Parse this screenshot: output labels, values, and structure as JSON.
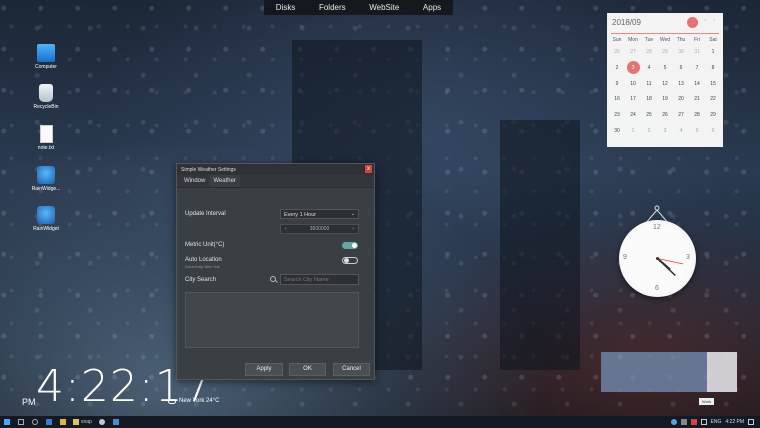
{
  "topbar": {
    "items": [
      "Disks",
      "Folders",
      "WebSite",
      "Apps"
    ]
  },
  "desktop_icons": [
    {
      "label": "Computer",
      "icon": "computer-icon"
    },
    {
      "label": "RecycleBin",
      "icon": "recycle-bin-icon"
    },
    {
      "label": "note.txt",
      "icon": "text-file-icon"
    },
    {
      "label": "RainWidge...",
      "icon": "rain-widget-icon"
    },
    {
      "label": "RainWidget",
      "icon": "rain-widget-gear-icon"
    }
  ],
  "big_clock": {
    "time": "4:22:17",
    "meridiem": "PM"
  },
  "weather_mini": {
    "text": "New York 24°C",
    "icon": "cloud-icon"
  },
  "dialog": {
    "title": "Simple Weather Settings",
    "close": "x",
    "tabs": [
      "Window",
      "Weather"
    ],
    "active_tab": "Weather",
    "update_interval_label": "Update Interval",
    "update_interval_value": "Every 1 Hour",
    "interval_seconds": "3600000",
    "metric_label": "Metric Unit(°C)",
    "metric_on": true,
    "auto_location_label": "Auto Location",
    "auto_location_sub": "Current city: New York",
    "auto_location_on": false,
    "city_search_label": "City Search",
    "city_search_placeholder": "Search City Name",
    "buttons": {
      "apply": "Apply",
      "ok": "OK",
      "cancel": "Cancel"
    }
  },
  "calendar": {
    "header": "2018/09",
    "weekdays": [
      "Sun",
      "Mon",
      "Tue",
      "Wed",
      "Thu",
      "Fri",
      "Sat"
    ],
    "weeks": [
      [
        "26",
        "27",
        "28",
        "29",
        "30",
        "31",
        "1"
      ],
      [
        "2",
        "3",
        "4",
        "5",
        "6",
        "7",
        "8"
      ],
      [
        "9",
        "10",
        "11",
        "12",
        "13",
        "14",
        "15"
      ],
      [
        "16",
        "17",
        "18",
        "19",
        "20",
        "21",
        "22"
      ],
      [
        "23",
        "24",
        "25",
        "26",
        "27",
        "28",
        "29"
      ],
      [
        "30",
        "1",
        "2",
        "3",
        "4",
        "5",
        "6"
      ]
    ],
    "today": "3",
    "accent": "#e57373"
  },
  "analog_clock": {
    "numerals": [
      "12",
      "3",
      "6",
      "9"
    ],
    "hour": 4,
    "minute": 22,
    "second": 17
  },
  "taskbar": {
    "app": "snap",
    "tray": {
      "language": "ENG",
      "time": "4:22 PM"
    }
  },
  "disk_widget": {
    "label": "Work"
  }
}
